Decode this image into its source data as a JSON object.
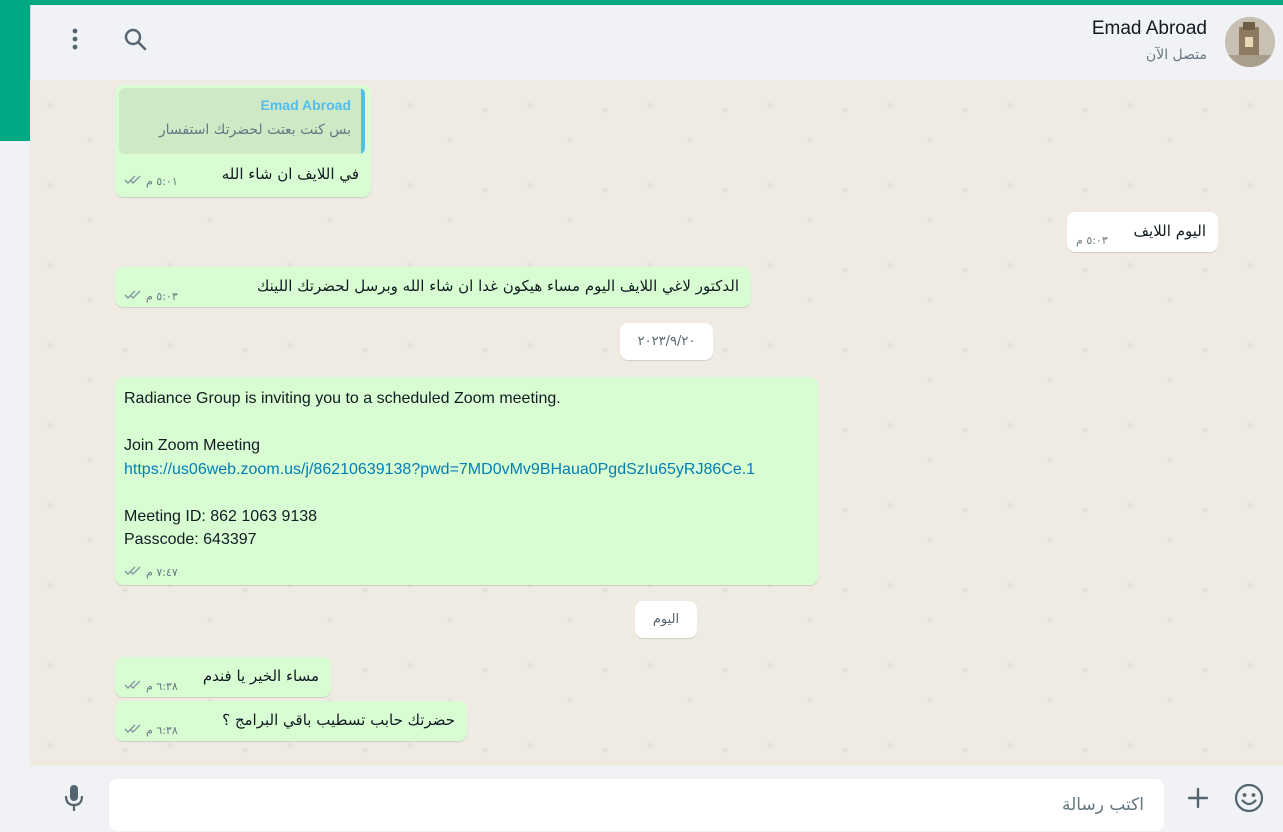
{
  "header": {
    "contact_name": "Emad Abroad",
    "contact_status": "متصل الآن",
    "menu_icon": "kebab-menu-icon",
    "search_icon": "search-icon"
  },
  "messages": [
    {
      "direction": "out",
      "quote": {
        "sender": "Emad Abroad",
        "text": "بس كنت بعتت لحضرتك استفسار"
      },
      "text": "في اللايف ان شاء الله",
      "time": "٥:٠١ م",
      "status": "read"
    },
    {
      "direction": "in",
      "text": "اليوم اللايف",
      "time": "٥:٠٣ م"
    },
    {
      "direction": "out",
      "text": "الدكتور لاغي اللايف اليوم مساء هيكون غدا ان شاء الله وبرسل لحضرتك اللينك",
      "time": "٥:٠٣ م",
      "status": "read"
    },
    {
      "direction": "out",
      "lines": [
        "Radiance Group is inviting you to a scheduled Zoom meeting.",
        "",
        "Join Zoom Meeting",
        "https://us06web.zoom.us/j/86210639138?pwd=7MD0vMv9BHaua0PgdSzIu65yRJ86Ce.1",
        "",
        "Meeting ID: 862 1063 9138",
        "Passcode: 643397"
      ],
      "time": "٧:٤٧ م",
      "status": "read"
    },
    {
      "direction": "out",
      "text": "مساء الخير يا فندم",
      "time": "٦:٣٨ م",
      "status": "read"
    },
    {
      "direction": "out",
      "text": "حضرتك حابب تسطيب باقي البرامج ؟",
      "time": "٦:٣٨ م",
      "status": "read"
    }
  ],
  "date_separators": [
    "٢٠٢٣/٩/٢٠",
    "اليوم"
  ],
  "composer": {
    "placeholder": "اكتب رسالة",
    "mic_icon": "microphone-icon",
    "attach_icon": "plus-icon",
    "emoji_icon": "emoji-icon"
  },
  "colors": {
    "accent": "#00a884",
    "outgoing_bubble": "#d9fdd3",
    "incoming_bubble": "#ffffff",
    "quote_name": "#53bdeb",
    "link": "#027eb5"
  }
}
